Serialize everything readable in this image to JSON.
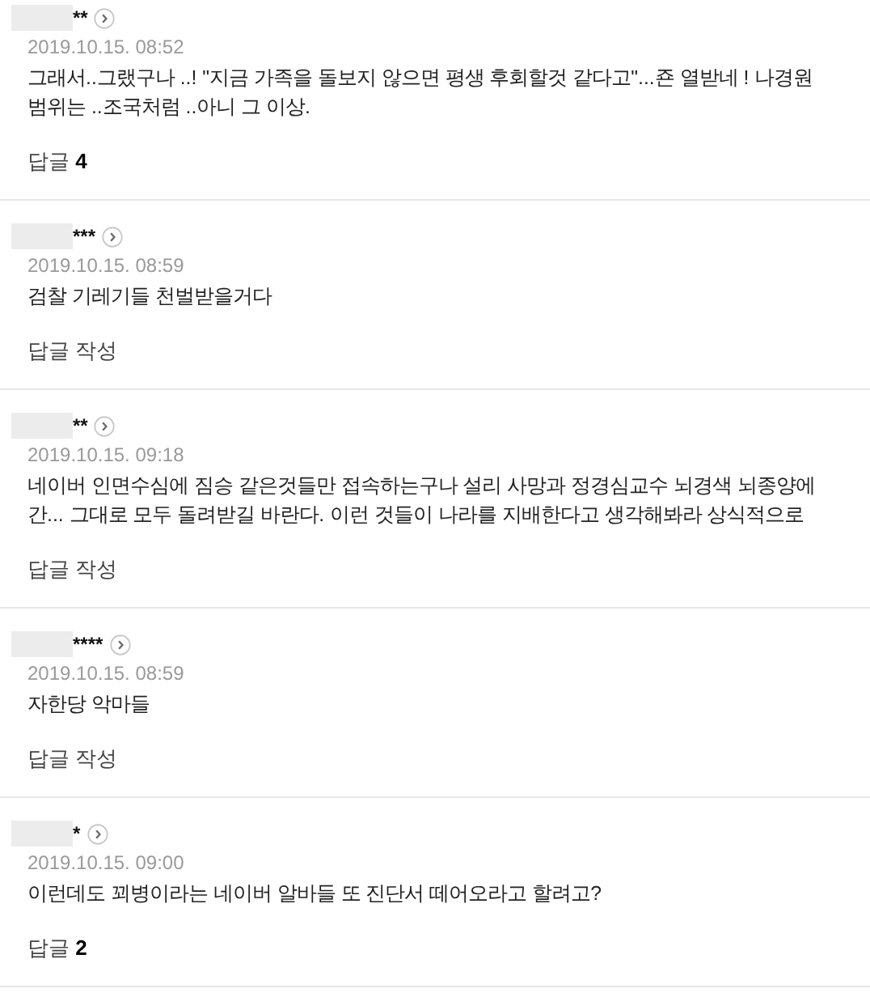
{
  "comments": [
    {
      "user": "**",
      "date": "2019.10.15. 08:52",
      "lines": [
        "그래서..그랬구나 ..! \"지금 가족을 돌보지 않으면 평생 후회할것 같다고\"...죤 열받네 ! 나경원",
        "범위는 ..조국처럼 ..아니 그 이상."
      ],
      "reply": {
        "label": "답글",
        "count": "4"
      }
    },
    {
      "user": "***",
      "date": "2019.10.15. 08:59",
      "lines": [
        "검찰 기레기들 천벌받을거다"
      ],
      "reply": {
        "label": "답글 작성"
      }
    },
    {
      "user": "**",
      "date": "2019.10.15. 09:18",
      "lines": [
        "네이버 인면수심에 짐승 같은것들만 접속하는구나 설리 사망과 정경심교수 뇌경색 뇌종양에",
        "간... 그대로 모두 돌려받길 바란다. 이런 것들이 나라를 지배한다고 생각해봐라 상식적으로"
      ],
      "reply": {
        "label": "답글 작성"
      }
    },
    {
      "user": "****",
      "date": "2019.10.15. 08:59",
      "lines": [
        "자한당 악마들"
      ],
      "reply": {
        "label": "답글 작성"
      }
    },
    {
      "user": "*",
      "date": "2019.10.15. 09:00",
      "lines": [
        "이런데도 꾀병이라는 네이버 알바들 또 진단서 떼어오라고 할려고?"
      ],
      "reply": {
        "label": "답글",
        "count": "2"
      }
    }
  ]
}
